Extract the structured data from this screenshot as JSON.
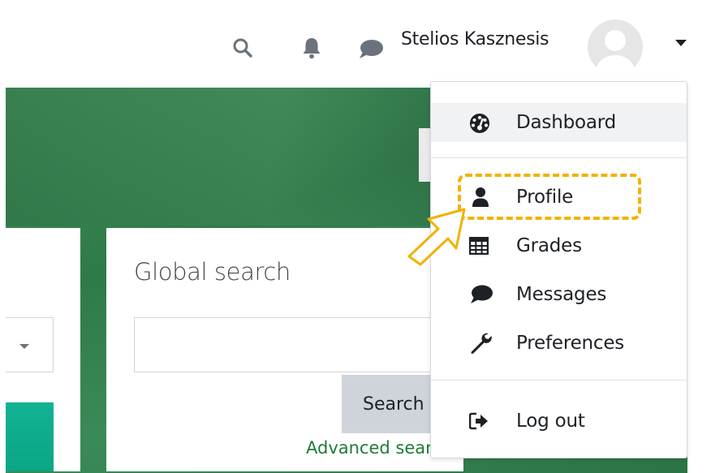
{
  "header": {
    "user_name": "Stelios Kasznesis",
    "icons": [
      "search-icon",
      "bell-icon",
      "message-icon",
      "caret-down-icon"
    ]
  },
  "user_menu": {
    "items": [
      {
        "label": "Dashboard",
        "icon": "dashboard-icon",
        "active": true
      },
      {
        "label": "Profile",
        "icon": "user-icon",
        "highlighted": true
      },
      {
        "label": "Grades",
        "icon": "table-icon"
      },
      {
        "label": "Messages",
        "icon": "comment-icon"
      },
      {
        "label": "Preferences",
        "icon": "wrench-icon"
      },
      {
        "label": "Log out",
        "icon": "sign-out-icon"
      }
    ]
  },
  "search_block": {
    "title": "Global search",
    "input_value": "",
    "button_label": "Search",
    "advanced_link": "Advanced search"
  },
  "colors": {
    "highlight": "#f2b200",
    "link": "#1f7a38",
    "hero_green": "#2f7a48",
    "button_gray": "#ced4da"
  }
}
